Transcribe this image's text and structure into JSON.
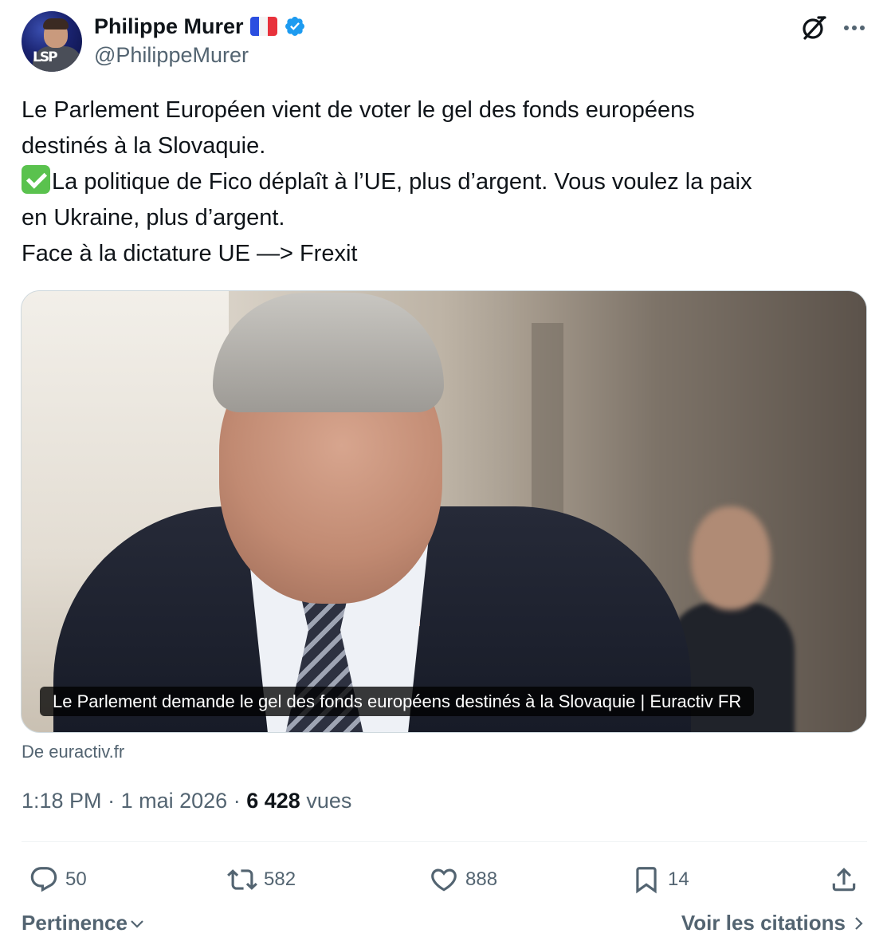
{
  "author": {
    "display_name": "Philippe Murer",
    "handle": "@PhilippeMurer",
    "avatar_text": "LSP",
    "flag": "france-flag-emoji",
    "verified": true
  },
  "header_icons": {
    "grok": "grok-icon",
    "more": "more-icon"
  },
  "tweet": {
    "lines": [
      "Le Parlement Européen vient de voter le gel des fonds européens",
      "destinés à la Slovaquie.",
      "La politique de Fico déplaît à l’UE, plus d’argent. Vous voulez la paix",
      "en Ukraine, plus d’argent.",
      "Face à la dictature UE —> Frexit"
    ],
    "emoji": "check-mark-button-emoji"
  },
  "card": {
    "caption": "Le Parlement demande le gel des fonds européens destinés à la Slovaquie | Euractiv FR",
    "source": "De euractiv.fr"
  },
  "meta": {
    "time": "1:18 PM",
    "separator": "·",
    "date": "1 mai 2026",
    "views_count": "6 428",
    "views_label": "vues"
  },
  "actions": {
    "replies": "50",
    "retweets": "582",
    "likes": "888",
    "bookmarks": "14"
  },
  "footer": {
    "sort_label": "Pertinence",
    "quotes_label": "Voir les citations"
  },
  "colors": {
    "text_primary": "#0f1419",
    "text_secondary": "#536471",
    "verified_blue": "#1d9bf0",
    "divider": "#eff3f4"
  }
}
